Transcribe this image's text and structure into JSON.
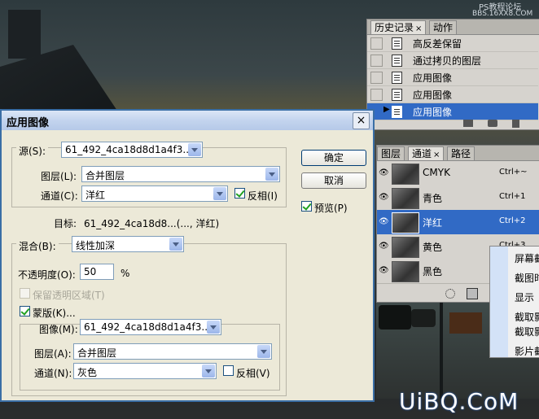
{
  "watermark": {
    "line1": "PS教程论坛",
    "line2": "BBS.16XX8.COM",
    "logo": "UiBQ.CoM"
  },
  "history_panel": {
    "tabs": [
      {
        "label": "历史记录",
        "close": "×"
      },
      {
        "label": "动作"
      }
    ],
    "items": [
      {
        "label": "高反差保留",
        "selected": false
      },
      {
        "label": "通过拷贝的图层",
        "selected": false
      },
      {
        "label": "应用图像",
        "selected": false
      },
      {
        "label": "应用图像",
        "selected": false
      },
      {
        "label": "应用图像",
        "selected": true
      }
    ]
  },
  "channels_panel": {
    "tabs": [
      {
        "label": "图层"
      },
      {
        "label": "通道",
        "close": "×"
      },
      {
        "label": "路径"
      }
    ],
    "items": [
      {
        "label": "CMYK",
        "shortcut": "Ctrl+~",
        "selected": false
      },
      {
        "label": "青色",
        "shortcut": "Ctrl+1",
        "selected": false
      },
      {
        "label": "洋红",
        "shortcut": "Ctrl+2",
        "selected": true
      },
      {
        "label": "黄色",
        "shortcut": "Ctrl+3",
        "selected": false
      },
      {
        "label": "黑色",
        "shortcut": "",
        "selected": false
      }
    ]
  },
  "context_menu": {
    "items": [
      "屏幕截",
      "截图时",
      "显示",
      "截取影",
      "截取影",
      "影片截"
    ]
  },
  "dialog": {
    "title": "应用图像",
    "close": "×",
    "source": {
      "label": "源(S):",
      "value": "61_492_4ca18d8d1a4f3...",
      "layer_label": "图层(L):",
      "layer_value": "合并图层",
      "channel_label": "通道(C):",
      "channel_value": "洋红",
      "invert_label": "反相(I)",
      "invert_checked": true
    },
    "target_label": "目标:",
    "target_value": "61_492_4ca18d8...(..., 洋红)",
    "blending": {
      "label": "混合(B):",
      "value": "线性加深",
      "opacity_label": "不透明度(O):",
      "opacity_value": "50",
      "opacity_unit": "%",
      "preserve_label": "保留透明区域(T)",
      "preserve_checked": false,
      "mask_label": "蒙版(K)...",
      "mask_checked": true,
      "mask_image_label": "图像(M):",
      "mask_image_value": "61_492_4ca18d8d1a4f3...",
      "mask_layer_label": "图层(A):",
      "mask_layer_value": "合并图层",
      "mask_channel_label": "通道(N):",
      "mask_channel_value": "灰色",
      "mask_invert_label": "反相(V)",
      "mask_invert_checked": false
    },
    "buttons": {
      "ok": "确定",
      "cancel": "取消"
    },
    "preview_label": "预览(P)",
    "preview_checked": true
  }
}
